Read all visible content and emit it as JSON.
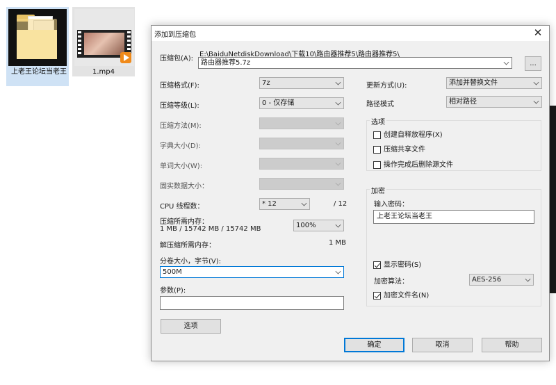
{
  "desktop": {
    "icons": [
      {
        "label": "上老王论坛当老王",
        "icon": "folder-icon"
      },
      {
        "label": "1.mp4",
        "icon": "video-file-icon"
      }
    ]
  },
  "dialog": {
    "title": "添加到压缩包",
    "close_glyph": "✕",
    "archive": {
      "label": "压缩包(A):",
      "path": "E:\\BaiduNetdiskDownload\\下载10\\路由器推荐5\\路由器推荐5\\",
      "name": "路由器推荐5.7z",
      "browse_label": "..."
    },
    "left": {
      "format": {
        "label": "压缩格式(F):",
        "value": "7z"
      },
      "level": {
        "label": "压缩等级(L):",
        "value": "0 - 仅存储"
      },
      "method": {
        "label": "压缩方法(M):",
        "value": ""
      },
      "dict": {
        "label": "字典大小(D):",
        "value": ""
      },
      "word": {
        "label": "单词大小(W):",
        "value": ""
      },
      "solid": {
        "label": "固实数据大小：",
        "value": ""
      },
      "cpu": {
        "label": "CPU 线程数：",
        "value": "* 12",
        "max": "/ 12"
      },
      "mem_compress": {
        "label": "压缩所需内存：",
        "detail": "1 MB / 15742 MB / 15742 MB",
        "value": "100%"
      },
      "mem_decompress": {
        "label": "解压缩所需内存：",
        "value": "1 MB"
      },
      "volume": {
        "label": "分卷大小，字节(V):",
        "value": "500M"
      },
      "params": {
        "label": "参数(P):",
        "value": ""
      },
      "options_button": "选项"
    },
    "right": {
      "update": {
        "label": "更新方式(U):",
        "value": "添加并替换文件"
      },
      "path_mode": {
        "label": "路径模式",
        "value": "相对路径"
      },
      "options_group": {
        "title": "选项",
        "sfx": {
          "label": "创建自释放程序(X)",
          "checked": false
        },
        "shared": {
          "label": "压缩共享文件",
          "checked": false
        },
        "delete_after": {
          "label": "操作完成后删除源文件",
          "checked": false
        }
      },
      "encryption": {
        "title": "加密",
        "password_label": "输入密码：",
        "password_value": "上老王论坛当老王",
        "show_password": {
          "label": "显示密码(S)",
          "checked": true
        },
        "method_label": "加密算法：",
        "method_value": "AES-256",
        "encrypt_names": {
          "label": "加密文件名(N)",
          "checked": true
        }
      }
    },
    "buttons": {
      "ok": "确定",
      "cancel": "取消",
      "help": "帮助"
    }
  }
}
